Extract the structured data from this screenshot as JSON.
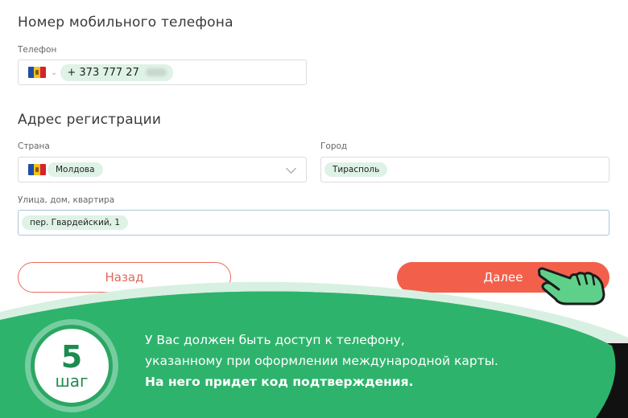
{
  "phone_section": {
    "title": "Номер мобильного телефона",
    "phone_label": "Телефон",
    "phone_value": "+ 373 777 27"
  },
  "address_section": {
    "title": "Адрес регистрации",
    "country_label": "Страна",
    "country_value": "Молдова",
    "city_label": "Город",
    "city_value": "Тирасполь",
    "street_label": "Улица, дом, квартира",
    "street_value": "пер. Гвардейский, 1"
  },
  "buttons": {
    "back_label": "Назад",
    "next_label": "Далее"
  },
  "step": {
    "number": "5",
    "word": "шаг",
    "line1": "У Вас должен быть доступ к телефону,",
    "line2": "указанному при оформлении международной карты.",
    "line3": "На него придет код подтверждения."
  },
  "colors": {
    "accent_green": "#2aa763",
    "button_red": "#f2604c",
    "chip_green": "#dff2e6"
  },
  "icons": [
    "moldova-flag-icon",
    "chevron-down-icon",
    "pointing-hand-icon"
  ]
}
